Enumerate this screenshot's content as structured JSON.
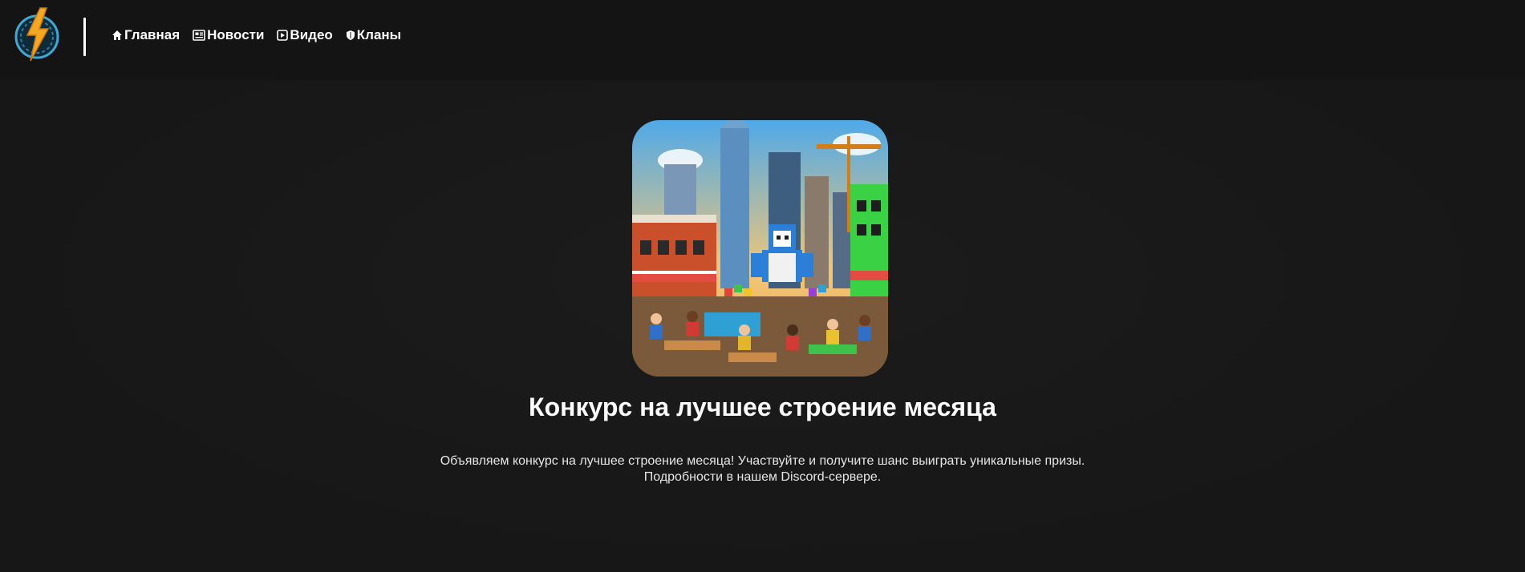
{
  "header": {
    "logo": {
      "icon": "lightning-bolt-logo",
      "colors": [
        "#f5a623",
        "#3fa9d6"
      ]
    },
    "nav": [
      {
        "label": "Главная",
        "icon": "home-icon"
      },
      {
        "label": "Новости",
        "icon": "newspaper-icon"
      },
      {
        "label": "Видео",
        "icon": "video-icon"
      },
      {
        "label": "Кланы",
        "icon": "shield-icon"
      }
    ]
  },
  "main": {
    "image": {
      "subject": "blocky-city-building-contest-illustration"
    },
    "title": "Конкурс на лучшее строение месяца",
    "description_line1": "Объявляем конкурс на лучшее строение месяца! Участвуйте и получите шанс выиграть уникальные призы.",
    "description_line2": "Подробности в нашем Discord-сервере."
  },
  "colors": {
    "background": "#181818",
    "header": "#141414",
    "text": "#ffffff"
  }
}
